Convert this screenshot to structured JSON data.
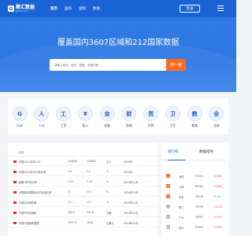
{
  "header": {
    "logo_mark": "G",
    "logo_name": "聚汇数据",
    "logo_sub": "gotohui.com",
    "nav": [
      "首页",
      "国内",
      "国际",
      "数据"
    ],
    "login_label": "登录"
  },
  "hero": {
    "title": "覆盖国内3607区域和212国家数据",
    "search_placeholder": "请输入城市、省份、国家、关键词等",
    "search_button": "搜一搜"
  },
  "categories": [
    {
      "glyph": "G",
      "label": "GDP"
    },
    {
      "glyph": "人",
      "label": "人口"
    },
    {
      "glyph": "工",
      "label": "工资"
    },
    {
      "glyph": "¥",
      "label": "收入"
    },
    {
      "glyph": "金",
      "label": "金融"
    },
    {
      "glyph": "财",
      "label": "财政"
    },
    {
      "glyph": "贸",
      "label": "外贸"
    },
    {
      "glyph": "卫",
      "label": "卫生"
    },
    {
      "glyph": "教",
      "label": "教育"
    },
    {
      "glyph": "全",
      "label": "全球"
    }
  ],
  "table": {
    "header": {
      "name": "数据",
      "v1": "",
      "v2": "",
      "unit": "",
      "date": "",
      "action": ""
    },
    "rows": [
      {
        "name": "中国2024年总人口",
        "v1": "140828",
        "v2": "140967",
        "unit": "万人",
        "date": "2024年",
        "action": "··"
      },
      {
        "name": "中国2024年GDP增长率",
        "v1": "5.0",
        "v2": "5.2",
        "unit": "%",
        "date": "2024年",
        "action": "··"
      },
      {
        "name": "越南GDP增长率",
        "v1": "7.55",
        "v2": "7.43",
        "unit": "%",
        "date": "2024年12月",
        "action": "··"
      },
      {
        "name": "中国新增城镇就业同比增长率",
        "v1": "-5",
        "v2": "-6.5",
        "unit": "%",
        "date": "2024年12月",
        "action": "··"
      },
      {
        "name": "中国住宅销售额",
        "v1": "-0.1",
        "v2": "-0.7",
        "unit": "%",
        "date": "2024年12月",
        "action": "··"
      },
      {
        "name": "中国汽车总销量",
        "v1": "349.3",
        "v2": "331.6",
        "unit": "万辆",
        "date": "2024年12月",
        "action": "··"
      },
      {
        "name": "中国中国最新数据",
        "v1": "1147.5",
        "v2": "1046",
        "unit": "亿美元",
        "date": "2024年12月",
        "action": "··"
      }
    ]
  },
  "ranking": {
    "tab_active": "排行榜",
    "tab_other": "数据指导",
    "header": {
      "rank": "",
      "name": "",
      "value": "",
      "change": ""
    },
    "rows": [
      {
        "rank": "1",
        "name": "深圳",
        "value": "97141",
        "change": "+4.8%",
        "dir": "up"
      },
      {
        "rank": "2",
        "name": "上海",
        "value": "85161",
        "change": "+5.0%",
        "dir": "up"
      },
      {
        "rank": "3",
        "name": "北京",
        "value": "45110",
        "change": "-0.2%",
        "dir": "down"
      },
      {
        "rank": "4",
        "name": "厦门",
        "value": "35100",
        "change": "+4.1%",
        "dir": "up"
      },
      {
        "rank": "5",
        "name": "广州",
        "value": "35005",
        "change": "+2.1%",
        "dir": "up"
      },
      {
        "rank": "6",
        "name": "杭州",
        "value": "35400",
        "change": "+2.5%",
        "dir": "up"
      }
    ]
  },
  "colors": {
    "brand": "#1a63d6",
    "accent": "#ff6a1f",
    "up": "#e53935",
    "down": "#2e9b48",
    "rank_top": "#ff6a1f",
    "rank_other": "#b0b8c4"
  }
}
